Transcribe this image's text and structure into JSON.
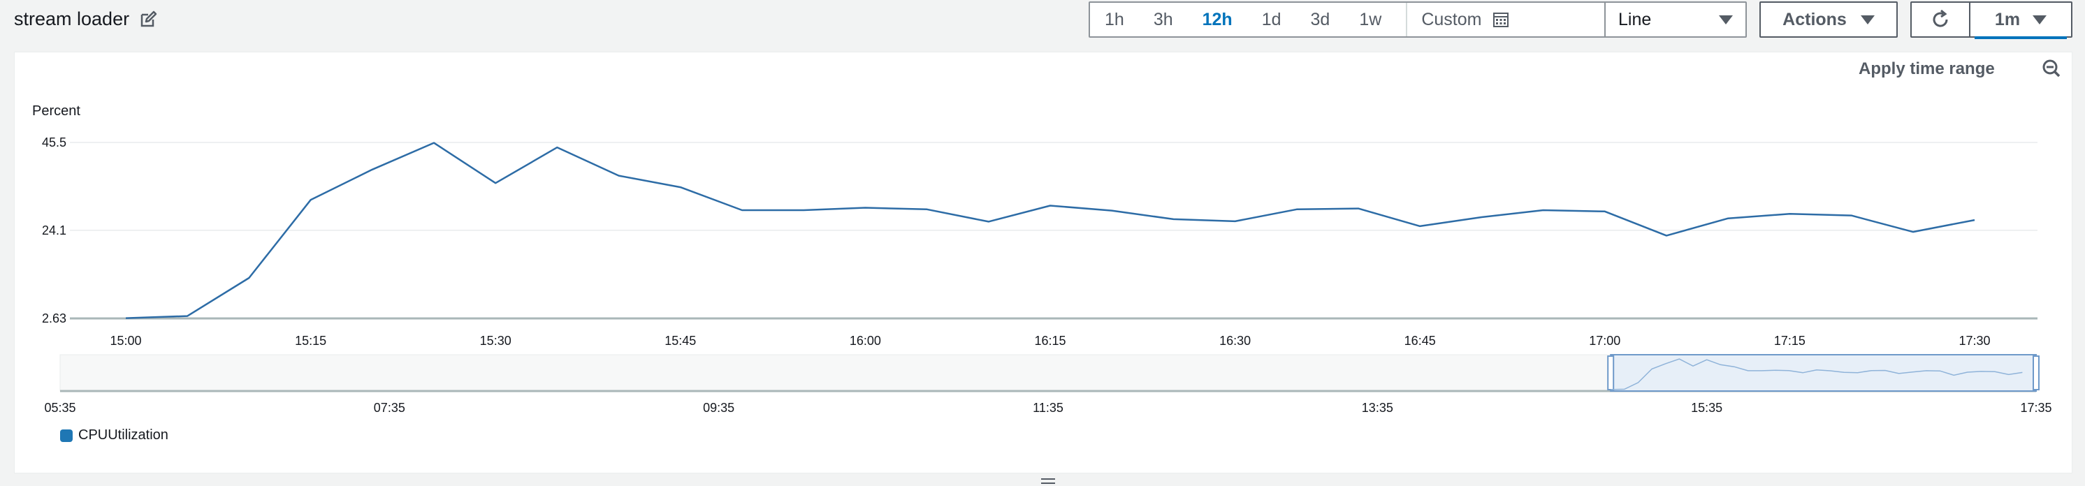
{
  "header": {
    "title": "stream loader",
    "time_ranges": [
      "1h",
      "3h",
      "12h",
      "1d",
      "3d",
      "1w"
    ],
    "active_range": "12h",
    "custom_label": "Custom",
    "chart_type_select": "Line",
    "actions_label": "Actions",
    "refresh_interval": "1m"
  },
  "panel": {
    "apply_time_range_label": "Apply time range"
  },
  "colors": {
    "series": "#2d6ca6",
    "active": "#0073bb"
  },
  "chart_data": {
    "type": "line",
    "ylabel": "Percent",
    "yticks": [
      "2.63",
      "24.1",
      "45.5"
    ],
    "ylim": [
      2.63,
      45.5
    ],
    "xticks": [
      "15:00",
      "15:15",
      "15:30",
      "15:45",
      "16:00",
      "16:15",
      "16:30",
      "16:45",
      "17:00",
      "17:15",
      "17:30"
    ],
    "x_minutes": [
      0,
      5,
      10,
      15,
      20,
      25,
      30,
      35,
      40,
      45,
      50,
      55,
      60,
      65,
      70,
      75,
      80,
      85,
      90,
      95,
      100,
      105,
      110,
      115,
      120,
      125,
      130,
      135,
      140,
      145,
      150
    ],
    "series": [
      {
        "name": "CPUUtilization",
        "values": [
          2.7,
          3.2,
          12.5,
          31.5,
          38.9,
          45.4,
          35.6,
          44.3,
          37.4,
          34.6,
          29.0,
          29.0,
          29.6,
          29.2,
          26.2,
          30.1,
          28.9,
          26.8,
          26.3,
          29.2,
          29.4,
          25.1,
          27.3,
          29.0,
          28.7,
          22.8,
          27.0,
          28.1,
          27.7,
          23.7,
          26.6
        ]
      }
    ],
    "grid": true,
    "legend_position": "bottom-left",
    "navigator": {
      "xticks": [
        "05:35",
        "07:35",
        "09:35",
        "11:35",
        "13:35",
        "15:35",
        "17:35"
      ],
      "selected_range": [
        "15:00",
        "17:35"
      ]
    }
  }
}
